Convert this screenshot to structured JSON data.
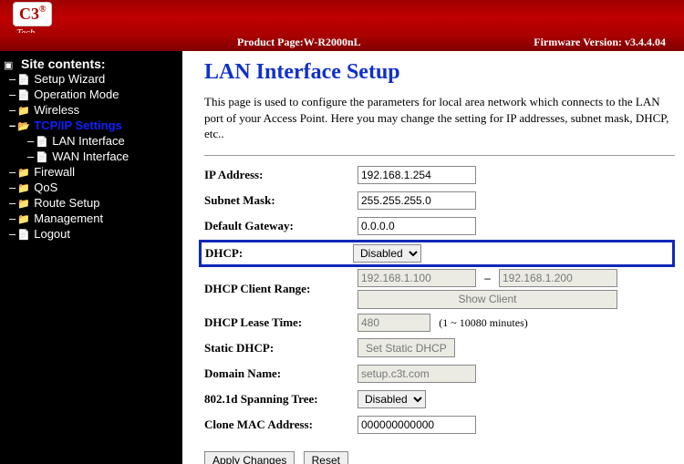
{
  "header": {
    "logo_text": "C3",
    "logo_sub": "Tech",
    "product_label": "Product Page:",
    "product_value": "W-R2000nL",
    "firmware_label": "Firmware Version:",
    "firmware_value": "v3.4.4.04"
  },
  "sidebar": {
    "title": "Site contents:",
    "items": [
      {
        "label": "Setup Wizard",
        "type": "page"
      },
      {
        "label": "Operation Mode",
        "type": "page"
      },
      {
        "label": "Wireless",
        "type": "folder"
      },
      {
        "label": "TCP/IP Settings",
        "type": "folder-open",
        "active": true
      },
      {
        "label": "LAN Interface",
        "type": "page",
        "child": true
      },
      {
        "label": "WAN Interface",
        "type": "page",
        "child": true
      },
      {
        "label": "Firewall",
        "type": "folder"
      },
      {
        "label": "QoS",
        "type": "folder"
      },
      {
        "label": "Route Setup",
        "type": "folder"
      },
      {
        "label": "Management",
        "type": "folder"
      },
      {
        "label": "Logout",
        "type": "page"
      }
    ]
  },
  "page": {
    "title": "LAN Interface Setup",
    "description": "This page is used to configure the parameters for local area network which connects to the LAN port of your Access Point. Here you may change the setting for IP addresses, subnet mask, DHCP, etc.."
  },
  "form": {
    "ip_label": "IP Address:",
    "ip_value": "192.168.1.254",
    "subnet_label": "Subnet Mask:",
    "subnet_value": "255.255.255.0",
    "gateway_label": "Default Gateway:",
    "gateway_value": "0.0.0.0",
    "dhcp_label": "DHCP:",
    "dhcp_value": "Disabled",
    "range_label": "DHCP Client Range:",
    "range_start": "192.168.1.100",
    "range_sep": "–",
    "range_end": "192.168.1.200",
    "show_client": "Show Client",
    "lease_label": "DHCP Lease Time:",
    "lease_value": "480",
    "lease_note": "(1 ~ 10080 minutes)",
    "static_label": "Static DHCP:",
    "static_button": "Set Static DHCP",
    "domain_label": "Domain Name:",
    "domain_value": "setup.c3t.com",
    "stp_label": "802.1d Spanning Tree:",
    "stp_value": "Disabled",
    "mac_label": "Clone MAC Address:",
    "mac_value": "000000000000",
    "apply": "Apply Changes",
    "reset": "Reset"
  }
}
